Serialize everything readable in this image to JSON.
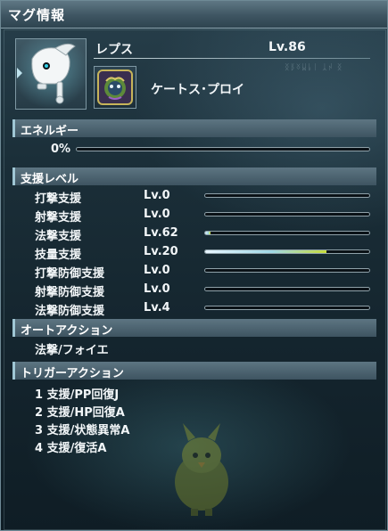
{
  "window": {
    "title": "マグ情報"
  },
  "mag": {
    "name": "レプス",
    "level": "Lv.86",
    "photon_blast": "ケートス･プロイ"
  },
  "energy": {
    "header": "エネルギー",
    "value_text": "0%",
    "fraction": 0.0
  },
  "support": {
    "header": "支援レベル",
    "stats": [
      {
        "name": "打撃支援",
        "level": "Lv.0",
        "fraction": 0.0
      },
      {
        "name": "射撃支援",
        "level": "Lv.0",
        "fraction": 0.0
      },
      {
        "name": "法撃支援",
        "level": "Lv.62",
        "fraction": 0.03
      },
      {
        "name": "技量支援",
        "level": "Lv.20",
        "fraction": 0.74
      },
      {
        "name": "打撃防御支援",
        "level": "Lv.0",
        "fraction": 0.0
      },
      {
        "name": "射撃防御支援",
        "level": "Lv.0",
        "fraction": 0.0
      },
      {
        "name": "法撃防御支援",
        "level": "Lv.4",
        "fraction": 0.0
      }
    ]
  },
  "auto_action": {
    "header": "オートアクション",
    "items": [
      "法撃/フォイエ"
    ]
  },
  "trigger_action": {
    "header": "トリガーアクション",
    "items": [
      "1 支援/PP回復J",
      "2 支援/HP回復A",
      "3 支援/状態異常A",
      "4 支援/復活A"
    ]
  },
  "colors": {
    "bar_fill_start": "#e8f6ff",
    "bar_fill_mid": "#9fd8e6",
    "bar_fill_end": "#c8dc3a"
  },
  "icons": {
    "portrait": "mag-portrait-icon",
    "photon_blast": "photon-blast-icon"
  }
}
